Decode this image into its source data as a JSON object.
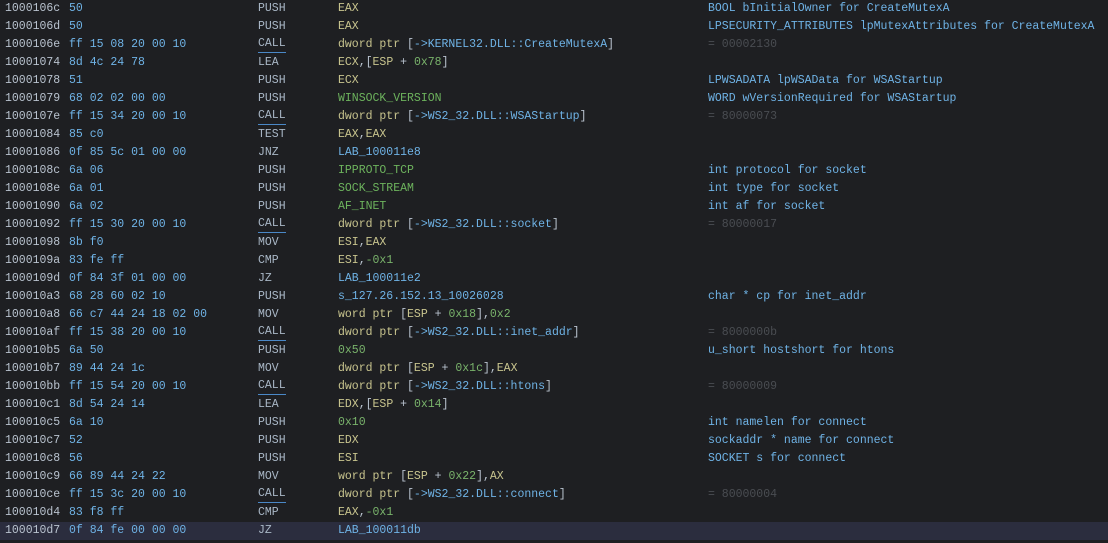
{
  "colors": {
    "background": "#1e1f22",
    "selected_row": "#2b2d3e",
    "address": "#b9c3cf",
    "bytes": "#6fb3e6",
    "register": "#c8c48e",
    "number": "#79b36b",
    "constant": "#6db35d",
    "reference": "#6fb3e6",
    "comment": "#6fb3e6",
    "return_value": "#4a4d52"
  },
  "rows": [
    {
      "addr": "1000106c",
      "bytes": "50",
      "mnem": "PUSH",
      "ops": [
        {
          "t": "reg",
          "v": "EAX"
        }
      ],
      "comment": "BOOL bInitialOwner for CreateMutexA",
      "ctype": "param"
    },
    {
      "addr": "1000106d",
      "bytes": "50",
      "mnem": "PUSH",
      "ops": [
        {
          "t": "reg",
          "v": "EAX"
        }
      ],
      "comment": "LPSECURITY_ATTRIBUTES lpMutexAttributes for CreateMutexA",
      "ctype": "param"
    },
    {
      "addr": "1000106e",
      "bytes": "ff 15 08 20 00 10",
      "mnem": "CALL",
      "ops": [
        {
          "t": "ptr",
          "v": "dword ptr "
        },
        {
          "t": "punc",
          "v": "["
        },
        {
          "t": "ref",
          "v": "->KERNEL32.DLL::CreateMutexA"
        },
        {
          "t": "punc",
          "v": "]"
        }
      ],
      "comment": "= 00002130",
      "ctype": "ret"
    },
    {
      "addr": "10001074",
      "bytes": "8d 4c 24 78",
      "mnem": "LEA",
      "ops": [
        {
          "t": "reg",
          "v": "ECX"
        },
        {
          "t": "punc",
          "v": ",["
        },
        {
          "t": "reg",
          "v": "ESP"
        },
        {
          "t": "punc",
          "v": " + "
        },
        {
          "t": "num",
          "v": "0x78"
        },
        {
          "t": "punc",
          "v": "]"
        }
      ],
      "comment": "",
      "ctype": "param"
    },
    {
      "addr": "10001078",
      "bytes": "51",
      "mnem": "PUSH",
      "ops": [
        {
          "t": "reg",
          "v": "ECX"
        }
      ],
      "comment": "LPWSADATA lpWSAData for WSAStartup",
      "ctype": "param"
    },
    {
      "addr": "10001079",
      "bytes": "68 02 02 00 00",
      "mnem": "PUSH",
      "ops": [
        {
          "t": "const",
          "v": "WINSOCK_VERSION"
        }
      ],
      "comment": "WORD wVersionRequired for WSAStartup",
      "ctype": "param"
    },
    {
      "addr": "1000107e",
      "bytes": "ff 15 34 20 00 10",
      "mnem": "CALL",
      "ops": [
        {
          "t": "ptr",
          "v": "dword ptr "
        },
        {
          "t": "punc",
          "v": "["
        },
        {
          "t": "ref",
          "v": "->WS2_32.DLL::WSAStartup"
        },
        {
          "t": "punc",
          "v": "]"
        }
      ],
      "comment": "= 80000073",
      "ctype": "ret"
    },
    {
      "addr": "10001084",
      "bytes": "85 c0",
      "mnem": "TEST",
      "ops": [
        {
          "t": "reg",
          "v": "EAX"
        },
        {
          "t": "punc",
          "v": ","
        },
        {
          "t": "reg",
          "v": "EAX"
        }
      ],
      "comment": "",
      "ctype": "param"
    },
    {
      "addr": "10001086",
      "bytes": "0f 85 5c 01 00 00",
      "mnem": "JNZ",
      "ops": [
        {
          "t": "lab",
          "v": "LAB_100011e8"
        }
      ],
      "comment": "",
      "ctype": "param"
    },
    {
      "addr": "1000108c",
      "bytes": "6a 06",
      "mnem": "PUSH",
      "ops": [
        {
          "t": "const",
          "v": "IPPROTO_TCP"
        }
      ],
      "comment": "int protocol for socket",
      "ctype": "param"
    },
    {
      "addr": "1000108e",
      "bytes": "6a 01",
      "mnem": "PUSH",
      "ops": [
        {
          "t": "const",
          "v": "SOCK_STREAM"
        }
      ],
      "comment": "int type for socket",
      "ctype": "param"
    },
    {
      "addr": "10001090",
      "bytes": "6a 02",
      "mnem": "PUSH",
      "ops": [
        {
          "t": "const",
          "v": "AF_INET"
        }
      ],
      "comment": "int af for socket",
      "ctype": "param"
    },
    {
      "addr": "10001092",
      "bytes": "ff 15 30 20 00 10",
      "mnem": "CALL",
      "ops": [
        {
          "t": "ptr",
          "v": "dword ptr "
        },
        {
          "t": "punc",
          "v": "["
        },
        {
          "t": "ref",
          "v": "->WS2_32.DLL::socket"
        },
        {
          "t": "punc",
          "v": "]"
        }
      ],
      "comment": "= 80000017",
      "ctype": "ret"
    },
    {
      "addr": "10001098",
      "bytes": "8b f0",
      "mnem": "MOV",
      "ops": [
        {
          "t": "reg",
          "v": "ESI"
        },
        {
          "t": "punc",
          "v": ","
        },
        {
          "t": "reg",
          "v": "EAX"
        }
      ],
      "comment": "",
      "ctype": "param"
    },
    {
      "addr": "1000109a",
      "bytes": "83 fe ff",
      "mnem": "CMP",
      "ops": [
        {
          "t": "reg",
          "v": "ESI"
        },
        {
          "t": "punc",
          "v": ","
        },
        {
          "t": "num",
          "v": "-0x1"
        }
      ],
      "comment": "",
      "ctype": "param"
    },
    {
      "addr": "1000109d",
      "bytes": "0f 84 3f 01 00 00",
      "mnem": "JZ",
      "ops": [
        {
          "t": "lab",
          "v": "LAB_100011e2"
        }
      ],
      "comment": "",
      "ctype": "param"
    },
    {
      "addr": "100010a3",
      "bytes": "68 28 60 02 10",
      "mnem": "PUSH",
      "ops": [
        {
          "t": "lab",
          "v": "s_127.26.152.13_10026028"
        }
      ],
      "comment": "char * cp for inet_addr",
      "ctype": "param"
    },
    {
      "addr": "100010a8",
      "bytes": "66 c7 44 24 18 02 00",
      "mnem": "MOV",
      "ops": [
        {
          "t": "ptr",
          "v": "word ptr "
        },
        {
          "t": "punc",
          "v": "["
        },
        {
          "t": "reg",
          "v": "ESP"
        },
        {
          "t": "punc",
          "v": " + "
        },
        {
          "t": "num",
          "v": "0x18"
        },
        {
          "t": "punc",
          "v": "],"
        },
        {
          "t": "num",
          "v": "0x2"
        }
      ],
      "comment": "",
      "ctype": "param"
    },
    {
      "addr": "100010af",
      "bytes": "ff 15 38 20 00 10",
      "mnem": "CALL",
      "ops": [
        {
          "t": "ptr",
          "v": "dword ptr "
        },
        {
          "t": "punc",
          "v": "["
        },
        {
          "t": "ref",
          "v": "->WS2_32.DLL::inet_addr"
        },
        {
          "t": "punc",
          "v": "]"
        }
      ],
      "comment": "= 8000000b",
      "ctype": "ret"
    },
    {
      "addr": "100010b5",
      "bytes": "6a 50",
      "mnem": "PUSH",
      "ops": [
        {
          "t": "num",
          "v": "0x50"
        }
      ],
      "comment": "u_short hostshort for htons",
      "ctype": "param"
    },
    {
      "addr": "100010b7",
      "bytes": "89 44 24 1c",
      "mnem": "MOV",
      "ops": [
        {
          "t": "ptr",
          "v": "dword ptr "
        },
        {
          "t": "punc",
          "v": "["
        },
        {
          "t": "reg",
          "v": "ESP"
        },
        {
          "t": "punc",
          "v": " + "
        },
        {
          "t": "num",
          "v": "0x1c"
        },
        {
          "t": "punc",
          "v": "],"
        },
        {
          "t": "reg",
          "v": "EAX"
        }
      ],
      "comment": "",
      "ctype": "param"
    },
    {
      "addr": "100010bb",
      "bytes": "ff 15 54 20 00 10",
      "mnem": "CALL",
      "ops": [
        {
          "t": "ptr",
          "v": "dword ptr "
        },
        {
          "t": "punc",
          "v": "["
        },
        {
          "t": "ref",
          "v": "->WS2_32.DLL::htons"
        },
        {
          "t": "punc",
          "v": "]"
        }
      ],
      "comment": "= 80000009",
      "ctype": "ret"
    },
    {
      "addr": "100010c1",
      "bytes": "8d 54 24 14",
      "mnem": "LEA",
      "ops": [
        {
          "t": "reg",
          "v": "EDX"
        },
        {
          "t": "punc",
          "v": ",["
        },
        {
          "t": "reg",
          "v": "ESP"
        },
        {
          "t": "punc",
          "v": " + "
        },
        {
          "t": "num",
          "v": "0x14"
        },
        {
          "t": "punc",
          "v": "]"
        }
      ],
      "comment": "",
      "ctype": "param"
    },
    {
      "addr": "100010c5",
      "bytes": "6a 10",
      "mnem": "PUSH",
      "ops": [
        {
          "t": "num",
          "v": "0x10"
        }
      ],
      "comment": "int namelen for connect",
      "ctype": "param"
    },
    {
      "addr": "100010c7",
      "bytes": "52",
      "mnem": "PUSH",
      "ops": [
        {
          "t": "reg",
          "v": "EDX"
        }
      ],
      "comment": "sockaddr * name for connect",
      "ctype": "param"
    },
    {
      "addr": "100010c8",
      "bytes": "56",
      "mnem": "PUSH",
      "ops": [
        {
          "t": "reg",
          "v": "ESI"
        }
      ],
      "comment": "SOCKET s for connect",
      "ctype": "param"
    },
    {
      "addr": "100010c9",
      "bytes": "66 89 44 24 22",
      "mnem": "MOV",
      "ops": [
        {
          "t": "ptr",
          "v": "word ptr "
        },
        {
          "t": "punc",
          "v": "["
        },
        {
          "t": "reg",
          "v": "ESP"
        },
        {
          "t": "punc",
          "v": " + "
        },
        {
          "t": "num",
          "v": "0x22"
        },
        {
          "t": "punc",
          "v": "],"
        },
        {
          "t": "reg",
          "v": "AX"
        }
      ],
      "comment": "",
      "ctype": "param"
    },
    {
      "addr": "100010ce",
      "bytes": "ff 15 3c 20 00 10",
      "mnem": "CALL",
      "ops": [
        {
          "t": "ptr",
          "v": "dword ptr "
        },
        {
          "t": "punc",
          "v": "["
        },
        {
          "t": "ref",
          "v": "->WS2_32.DLL::connect"
        },
        {
          "t": "punc",
          "v": "]"
        }
      ],
      "comment": "= 80000004",
      "ctype": "ret"
    },
    {
      "addr": "100010d4",
      "bytes": "83 f8 ff",
      "mnem": "CMP",
      "ops": [
        {
          "t": "reg",
          "v": "EAX"
        },
        {
          "t": "punc",
          "v": ","
        },
        {
          "t": "num",
          "v": "-0x1"
        }
      ],
      "comment": "",
      "ctype": "param"
    },
    {
      "addr": "100010d7",
      "bytes": "0f 84 fe 00 00 00",
      "mnem": "JZ",
      "ops": [
        {
          "t": "lab",
          "v": "LAB_100011db"
        }
      ],
      "comment": "",
      "ctype": "param",
      "selected": true
    }
  ]
}
